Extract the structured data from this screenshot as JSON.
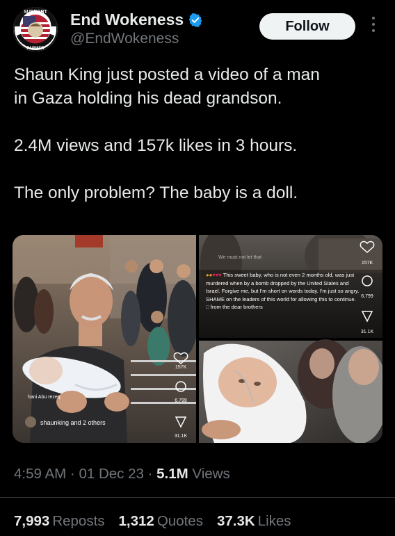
{
  "author": {
    "display_name": "End Wokeness",
    "handle": "@EndWokeness",
    "avatar_text_top": "SUPPORT",
    "avatar_text_bottom": "FARMER"
  },
  "follow_label": "Follow",
  "tweet": {
    "text": "Shaun King just posted a video of a man\nin Gaza holding his dead grandson.\n\n2.4M views and 157k likes in 3 hours.\n\nThe only problem? The baby is a doll."
  },
  "media": {
    "left_image": {
      "watermark": "hani Abu rezeq",
      "credit": "shaunking and 2 others",
      "likes": "157K",
      "comments": "6,799",
      "shares": "31.1K"
    },
    "top_right_image": {
      "header_text": "We must not let that",
      "caption": "This sweet baby, who is not even 2 months old, was just murdered when by a bomb dropped by the United States and Israel. Forgive me, but I'm short on words today. I'm just so angry. SHAME on the leaders of this world for allowing this to continue.",
      "caption_end": "from the dear brothers",
      "likes": "157K",
      "comments": "6,799",
      "shares": "31.1K"
    }
  },
  "meta": {
    "time": "4:59 AM",
    "date": "01 Dec 23",
    "views_count": "5.1M",
    "views_label": "Views"
  },
  "stats": {
    "reposts_count": "7,993",
    "reposts_label": "Reposts",
    "quotes_count": "1,312",
    "quotes_label": "Quotes",
    "likes_count": "37.3K",
    "likes_label": "Likes"
  },
  "colors": {
    "background": "#000000",
    "text": "#e7e9ea",
    "secondary_text": "#71767b",
    "verified": "#1d9bf0",
    "follow_bg": "#eff3f4"
  }
}
